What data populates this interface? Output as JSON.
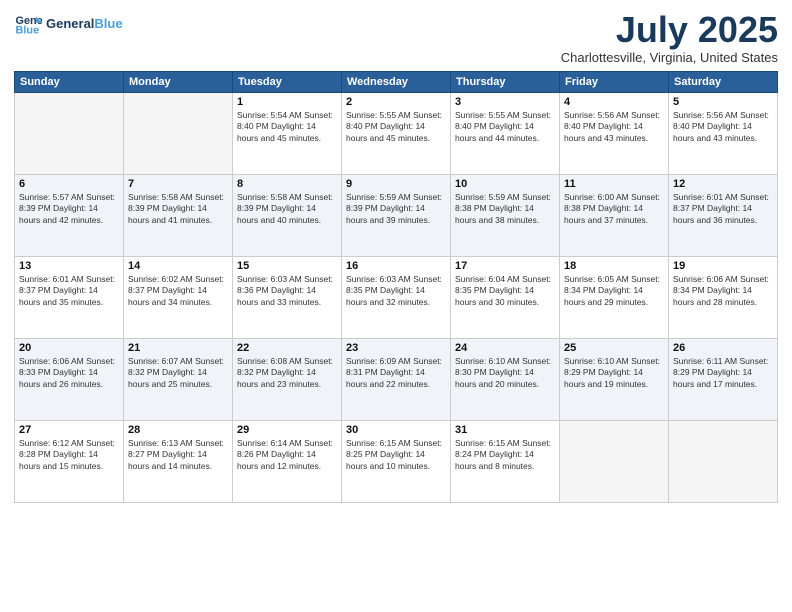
{
  "app": {
    "name": "GeneralBlue",
    "name_accent": "Blue"
  },
  "title": "July 2025",
  "location": "Charlottesville, Virginia, United States",
  "days_of_week": [
    "Sunday",
    "Monday",
    "Tuesday",
    "Wednesday",
    "Thursday",
    "Friday",
    "Saturday"
  ],
  "weeks": [
    [
      {
        "day": "",
        "info": ""
      },
      {
        "day": "",
        "info": ""
      },
      {
        "day": "1",
        "info": "Sunrise: 5:54 AM\nSunset: 8:40 PM\nDaylight: 14 hours and 45 minutes."
      },
      {
        "day": "2",
        "info": "Sunrise: 5:55 AM\nSunset: 8:40 PM\nDaylight: 14 hours and 45 minutes."
      },
      {
        "day": "3",
        "info": "Sunrise: 5:55 AM\nSunset: 8:40 PM\nDaylight: 14 hours and 44 minutes."
      },
      {
        "day": "4",
        "info": "Sunrise: 5:56 AM\nSunset: 8:40 PM\nDaylight: 14 hours and 43 minutes."
      },
      {
        "day": "5",
        "info": "Sunrise: 5:56 AM\nSunset: 8:40 PM\nDaylight: 14 hours and 43 minutes."
      }
    ],
    [
      {
        "day": "6",
        "info": "Sunrise: 5:57 AM\nSunset: 8:39 PM\nDaylight: 14 hours and 42 minutes."
      },
      {
        "day": "7",
        "info": "Sunrise: 5:58 AM\nSunset: 8:39 PM\nDaylight: 14 hours and 41 minutes."
      },
      {
        "day": "8",
        "info": "Sunrise: 5:58 AM\nSunset: 8:39 PM\nDaylight: 14 hours and 40 minutes."
      },
      {
        "day": "9",
        "info": "Sunrise: 5:59 AM\nSunset: 8:39 PM\nDaylight: 14 hours and 39 minutes."
      },
      {
        "day": "10",
        "info": "Sunrise: 5:59 AM\nSunset: 8:38 PM\nDaylight: 14 hours and 38 minutes."
      },
      {
        "day": "11",
        "info": "Sunrise: 6:00 AM\nSunset: 8:38 PM\nDaylight: 14 hours and 37 minutes."
      },
      {
        "day": "12",
        "info": "Sunrise: 6:01 AM\nSunset: 8:37 PM\nDaylight: 14 hours and 36 minutes."
      }
    ],
    [
      {
        "day": "13",
        "info": "Sunrise: 6:01 AM\nSunset: 8:37 PM\nDaylight: 14 hours and 35 minutes."
      },
      {
        "day": "14",
        "info": "Sunrise: 6:02 AM\nSunset: 8:37 PM\nDaylight: 14 hours and 34 minutes."
      },
      {
        "day": "15",
        "info": "Sunrise: 6:03 AM\nSunset: 8:36 PM\nDaylight: 14 hours and 33 minutes."
      },
      {
        "day": "16",
        "info": "Sunrise: 6:03 AM\nSunset: 8:35 PM\nDaylight: 14 hours and 32 minutes."
      },
      {
        "day": "17",
        "info": "Sunrise: 6:04 AM\nSunset: 8:35 PM\nDaylight: 14 hours and 30 minutes."
      },
      {
        "day": "18",
        "info": "Sunrise: 6:05 AM\nSunset: 8:34 PM\nDaylight: 14 hours and 29 minutes."
      },
      {
        "day": "19",
        "info": "Sunrise: 6:06 AM\nSunset: 8:34 PM\nDaylight: 14 hours and 28 minutes."
      }
    ],
    [
      {
        "day": "20",
        "info": "Sunrise: 6:06 AM\nSunset: 8:33 PM\nDaylight: 14 hours and 26 minutes."
      },
      {
        "day": "21",
        "info": "Sunrise: 6:07 AM\nSunset: 8:32 PM\nDaylight: 14 hours and 25 minutes."
      },
      {
        "day": "22",
        "info": "Sunrise: 6:08 AM\nSunset: 8:32 PM\nDaylight: 14 hours and 23 minutes."
      },
      {
        "day": "23",
        "info": "Sunrise: 6:09 AM\nSunset: 8:31 PM\nDaylight: 14 hours and 22 minutes."
      },
      {
        "day": "24",
        "info": "Sunrise: 6:10 AM\nSunset: 8:30 PM\nDaylight: 14 hours and 20 minutes."
      },
      {
        "day": "25",
        "info": "Sunrise: 6:10 AM\nSunset: 8:29 PM\nDaylight: 14 hours and 19 minutes."
      },
      {
        "day": "26",
        "info": "Sunrise: 6:11 AM\nSunset: 8:29 PM\nDaylight: 14 hours and 17 minutes."
      }
    ],
    [
      {
        "day": "27",
        "info": "Sunrise: 6:12 AM\nSunset: 8:28 PM\nDaylight: 14 hours and 15 minutes."
      },
      {
        "day": "28",
        "info": "Sunrise: 6:13 AM\nSunset: 8:27 PM\nDaylight: 14 hours and 14 minutes."
      },
      {
        "day": "29",
        "info": "Sunrise: 6:14 AM\nSunset: 8:26 PM\nDaylight: 14 hours and 12 minutes."
      },
      {
        "day": "30",
        "info": "Sunrise: 6:15 AM\nSunset: 8:25 PM\nDaylight: 14 hours and 10 minutes."
      },
      {
        "day": "31",
        "info": "Sunrise: 6:15 AM\nSunset: 8:24 PM\nDaylight: 14 hours and 8 minutes."
      },
      {
        "day": "",
        "info": ""
      },
      {
        "day": "",
        "info": ""
      }
    ]
  ]
}
